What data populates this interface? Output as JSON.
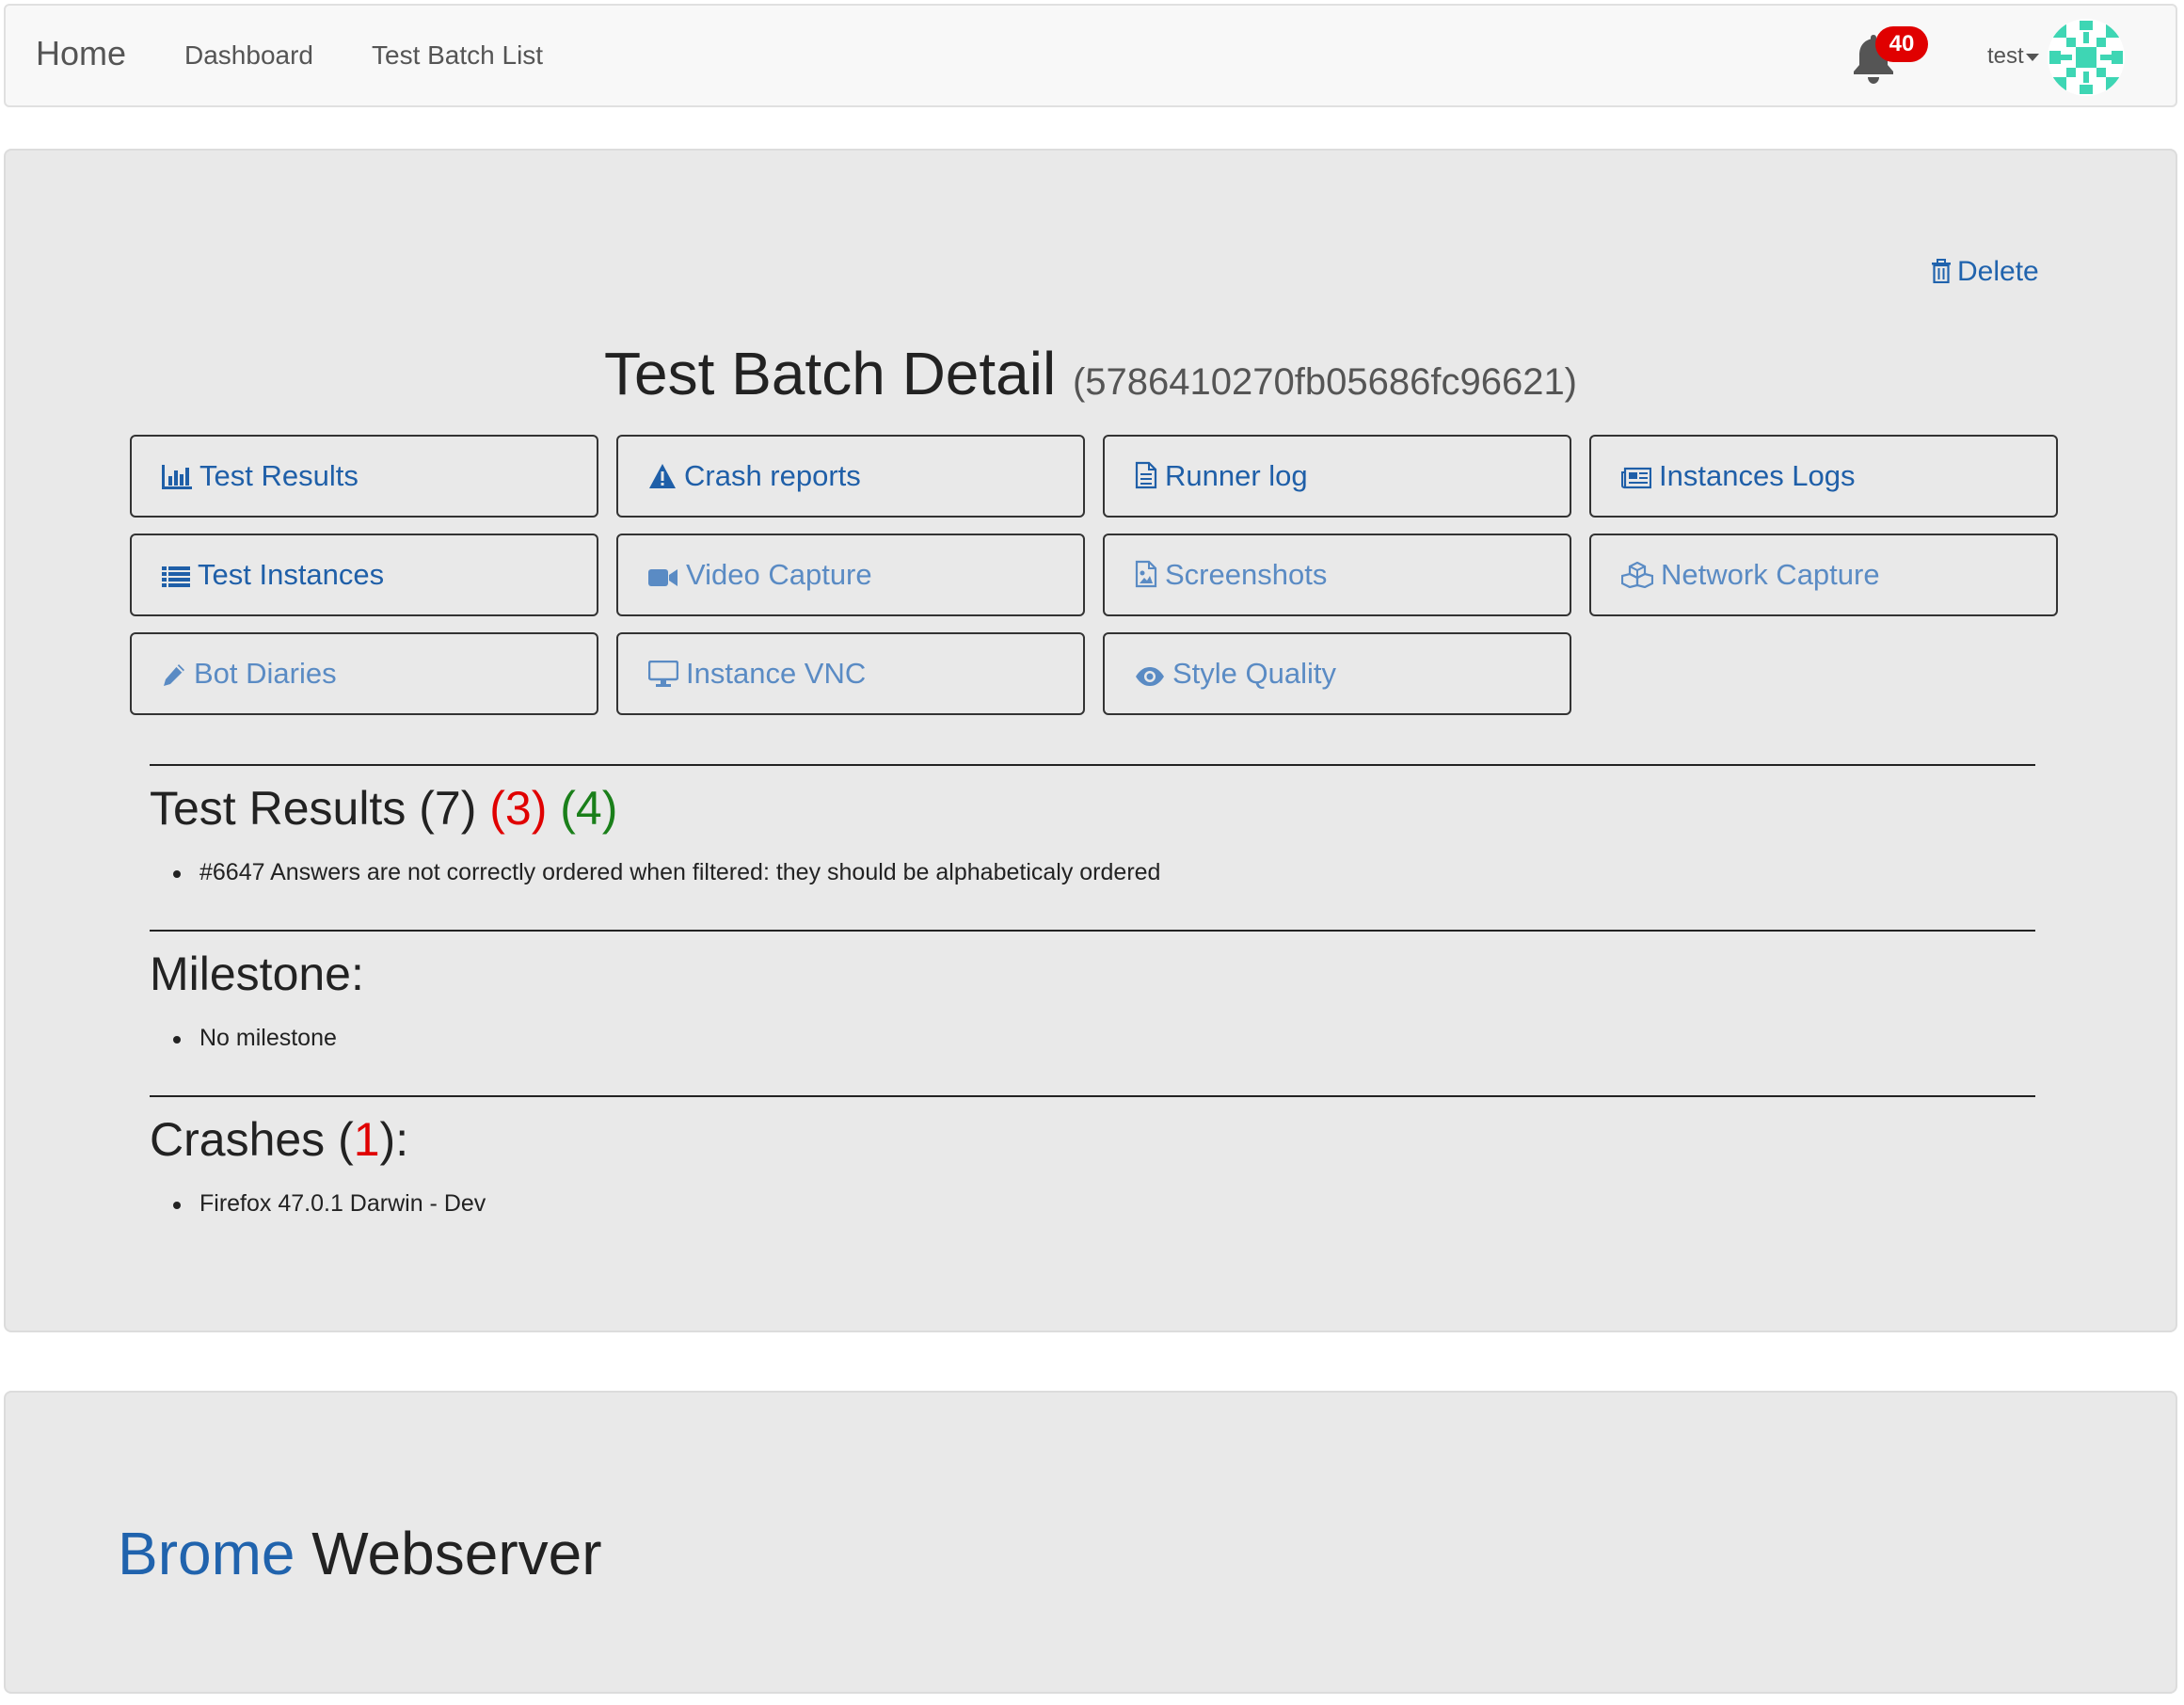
{
  "navbar": {
    "home": "Home",
    "links": [
      "Dashboard",
      "Test Batch List"
    ],
    "notification_count": "40",
    "user": "test"
  },
  "panel": {
    "delete_label": "Delete",
    "title": "Test Batch Detail",
    "batch_id": "(5786410270fb05686fc96621)",
    "buttons": [
      {
        "label": "Test Results",
        "icon": "bar-chart-icon",
        "enabled": true
      },
      {
        "label": "Crash reports",
        "icon": "warning-icon",
        "enabled": true
      },
      {
        "label": "Runner log",
        "icon": "file-icon",
        "enabled": true
      },
      {
        "label": "Instances Logs",
        "icon": "newspaper-icon",
        "enabled": true
      },
      {
        "label": "Test Instances",
        "icon": "list-icon",
        "enabled": true
      },
      {
        "label": "Video Capture",
        "icon": "video-camera-icon",
        "enabled": false
      },
      {
        "label": "Screenshots",
        "icon": "image-file-icon",
        "enabled": false
      },
      {
        "label": "Network Capture",
        "icon": "cubes-icon",
        "enabled": false
      },
      {
        "label": "Bot Diaries",
        "icon": "pencil-icon",
        "enabled": false
      },
      {
        "label": "Instance VNC",
        "icon": "desktop-icon",
        "enabled": false
      },
      {
        "label": "Style Quality",
        "icon": "eye-icon",
        "enabled": false
      }
    ],
    "sections": {
      "test_results": {
        "label": "Test Results",
        "total": "(7)",
        "failed": "(3)",
        "passed": "(4)",
        "items": [
          "#6647 Answers are not correctly ordered when filtered: they should be alphabeticaly ordered"
        ]
      },
      "milestone": {
        "label": "Milestone:",
        "items": [
          "No milestone"
        ]
      },
      "crashes": {
        "label_prefix": "Crashes (",
        "count": "1",
        "label_suffix": "):",
        "items": [
          "Firefox 47.0.1 Darwin - Dev"
        ]
      }
    }
  },
  "footer": {
    "brand": "Brome",
    "rest": "Webserver"
  },
  "colors": {
    "link": "#2063ad",
    "link_dim": "#5a8bc4",
    "badge": "#e00000",
    "fail": "#e00000",
    "pass": "#1a7f1a",
    "avatar": "#3ed6b4"
  }
}
